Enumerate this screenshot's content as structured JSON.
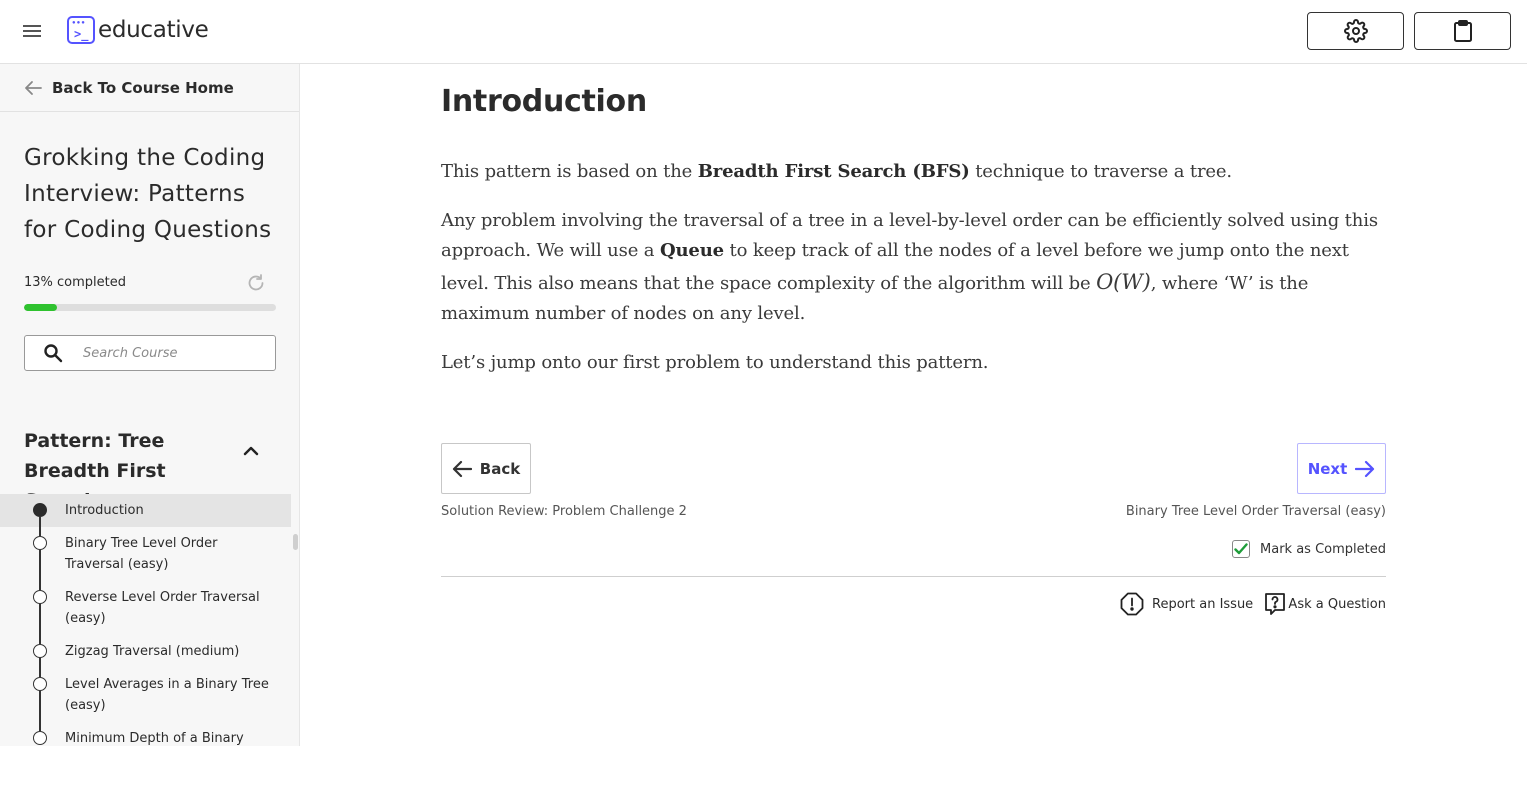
{
  "header": {
    "brand": "educative",
    "menu_icon": "hamburger-menu-icon",
    "settings_icon": "gear-icon",
    "clipboard_icon": "clipboard-icon"
  },
  "sidebar": {
    "back_label": "Back To Course Home",
    "course_title": "Grokking the Coding Interview: Patterns for Coding Questions",
    "progress_label": "13% completed",
    "progress_percent": 13,
    "search_placeholder": "Search Course",
    "section_title": "Pattern: Tree Breadth First Search",
    "lessons": [
      {
        "label": "Introduction",
        "active": true
      },
      {
        "label": "Binary Tree Level Order Traversal (easy)",
        "active": false
      },
      {
        "label": "Reverse Level Order Traversal (easy)",
        "active": false
      },
      {
        "label": "Zigzag Traversal (medium)",
        "active": false
      },
      {
        "label": "Level Averages in a Binary Tree (easy)",
        "active": false
      },
      {
        "label": "Minimum Depth of a Binary Tree (easy)",
        "active": false
      }
    ]
  },
  "main": {
    "title": "Introduction",
    "p1": {
      "before": "This pattern is based on the ",
      "bold": "Breadth First Search (BFS)",
      "after": " technique to traverse a tree."
    },
    "p2": {
      "before": "Any problem involving the traversal of a tree in a level-by-level order can be efficiently solved using this approach. We will use a ",
      "bold": "Queue",
      "middle": " to keep track of all the nodes of a level before we jump onto the next level. This also means that the space complexity of the algorithm will be ",
      "math": "O(W)",
      "after": ", where ‘W’ is the maximum number of nodes on any level."
    },
    "p3": "Let’s jump onto our first problem to understand this pattern.",
    "back_label": "Back",
    "next_label": "Next",
    "prev_lesson": "Solution Review: Problem Challenge 2",
    "next_lesson": "Binary Tree Level Order Traversal (easy)",
    "mark_completed_label": "Mark as Completed",
    "mark_completed_checked": true,
    "report_label": "Report an Issue",
    "ask_label": "Ask a Question"
  },
  "colors": {
    "accent": "#5553ff",
    "progress": "#2fc22f",
    "check": "#1f9d3a"
  }
}
